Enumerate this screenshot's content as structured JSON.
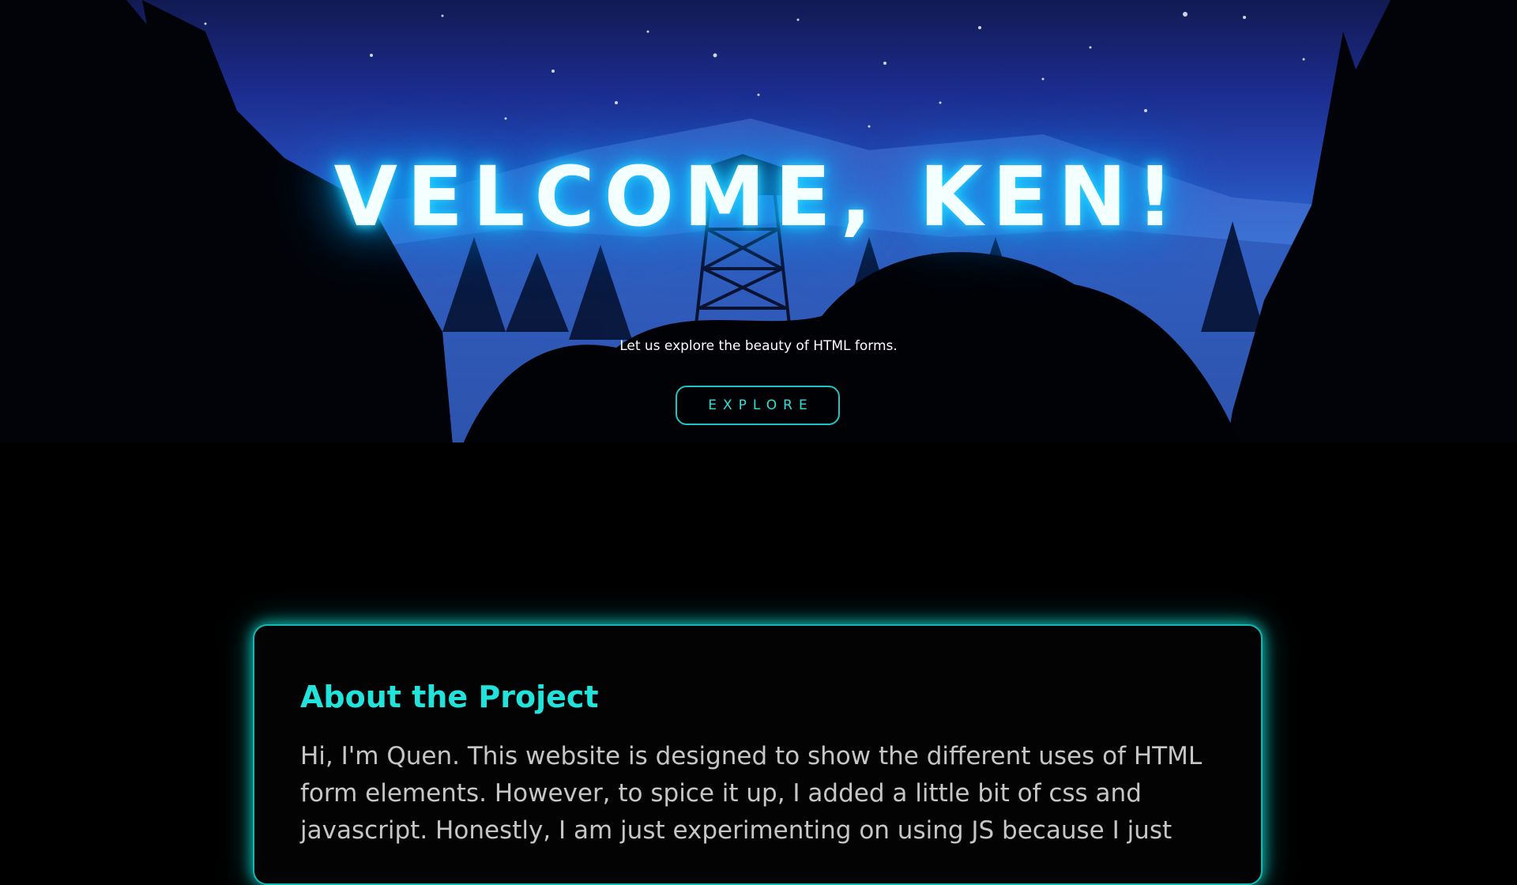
{
  "hero": {
    "title": "VELCOME, KEN!",
    "subtitle": "Let us explore the beauty of HTML forms.",
    "explore_label": "EXPLORE"
  },
  "about": {
    "title": "About the Project",
    "body": "Hi, I'm Quen. This website is designed to show the different uses of HTML form elements. However, to spice it up, I added a little bit of css and javascript. Honestly, I am just experimenting on using JS because I just"
  },
  "colors": {
    "accent": "#21e3dc",
    "glow": "#12c4ff",
    "background": "#000000"
  }
}
